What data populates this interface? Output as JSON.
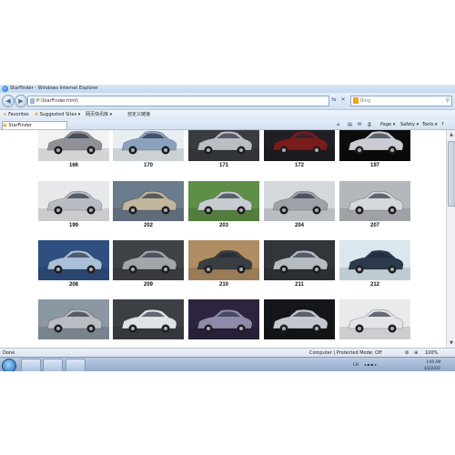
{
  "window": {
    "title": "StarFinder - Windows Internet Explorer"
  },
  "nav": {
    "address": "P:\\StarFinder.html\\",
    "search_placeholder": "Bing"
  },
  "favorites": {
    "favorites_label": "Favorites",
    "suggested_label": "Suggested Sites ▾",
    "item2_label": "网页快讯库 ▾",
    "item3_label": "自定义链接"
  },
  "tab": {
    "label": "StarFinder"
  },
  "commands": {
    "page": "Page ▾",
    "safety": "Safety ▾",
    "tools": "Tools ▾"
  },
  "gallery": {
    "items": [
      {
        "label": "166",
        "color": "#8e9297",
        "bg": "#f2f2f2"
      },
      {
        "label": "170",
        "color": "#8aa1bd",
        "bg": "#e9eef3"
      },
      {
        "label": "171",
        "color": "#b9bec4",
        "bg": "#3a3c40"
      },
      {
        "label": "172",
        "color": "#7a1c1c",
        "bg": "#1f1f24"
      },
      {
        "label": "197",
        "color": "#c9cdd3",
        "bg": "#0c0c0c"
      },
      {
        "label": "199",
        "color": "#b8bcc2",
        "bg": "#e7e8ea"
      },
      {
        "label": "202",
        "color": "#c2b79c",
        "bg": "#6b7c8c"
      },
      {
        "label": "203",
        "color": "#c6ccd2",
        "bg": "#5f8f46"
      },
      {
        "label": "204",
        "color": "#9da2a8",
        "bg": "#d3d8dd"
      },
      {
        "label": "207",
        "color": "#d4d7db",
        "bg": "#b4b8bd"
      },
      {
        "label": "208",
        "color": "#a9c0d8",
        "bg": "#2f4f80"
      },
      {
        "label": "209",
        "color": "#a2a6ab",
        "bg": "#404346"
      },
      {
        "label": "210",
        "color": "#3a3d42",
        "bg": "#b08d63"
      },
      {
        "label": "211",
        "color": "#b7bcc2",
        "bg": "#32363b"
      },
      {
        "label": "212",
        "color": "#2b3a4c",
        "bg": "#d9e7ef"
      },
      {
        "label": "",
        "color": "#b9bdc3",
        "bg": "#8b97a3"
      },
      {
        "label": "",
        "color": "#dfe2e6",
        "bg": "#3c3f44"
      },
      {
        "label": "",
        "color": "#8f8aa8",
        "bg": "#2d2540"
      },
      {
        "label": "",
        "color": "#c4c9cf",
        "bg": "#151619"
      },
      {
        "label": "",
        "color": "#e2e4e7",
        "bg": "#e8eaec"
      }
    ]
  },
  "status": {
    "left": "Done",
    "zone": "Computer | Protected Mode: Off",
    "zoom": "100%"
  },
  "clock": {
    "time": "3:00 AM",
    "date": "4/2/2010"
  },
  "tray": {
    "lang": "CH"
  }
}
